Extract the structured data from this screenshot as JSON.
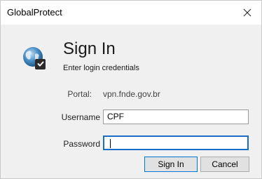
{
  "window": {
    "title": "GlobalProtect",
    "close_icon": "close-icon"
  },
  "header": {
    "heading": "Sign In",
    "subheading": "Enter login credentials",
    "icon": "globe-lock-icon"
  },
  "form": {
    "portal_label": "Portal:",
    "portal_value": "vpn.fnde.gov.br",
    "username_label": "Username",
    "username_value": "CPF",
    "password_label": "Password",
    "password_value": ""
  },
  "buttons": {
    "sign_in": "Sign In",
    "cancel": "Cancel"
  },
  "colors": {
    "accent": "#0078d7",
    "focus_border": "#1a6ec9"
  }
}
